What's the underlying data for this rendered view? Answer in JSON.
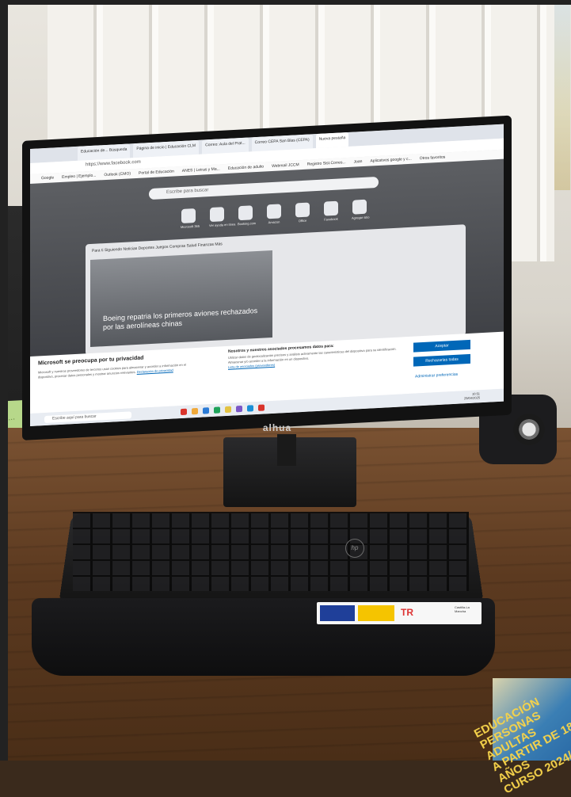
{
  "browser": {
    "tabs": [
      {
        "label": "Educación de... Búsqueda"
      },
      {
        "label": "Página de inicio | Educación CLM"
      },
      {
        "label": "Correo: Aula del Prat..."
      },
      {
        "label": "Correo CEPA San Blas (CEPA)"
      },
      {
        "label": "Nueva pestaña",
        "active": true
      }
    ],
    "url": "https://www.facebook.com",
    "bookmarks": [
      "Google",
      "Empleo | Ejemplo...",
      "Outlook (CMO)",
      "Portal de Educación",
      "ANES | Letras y Ma...",
      "Educación de adulto",
      "Webmail JCCM",
      "Registro Sist.Corres...",
      "Joan",
      "Aplicativos google y c...",
      "Otros favoritos"
    ],
    "search_placeholder": "Escribe para buscar"
  },
  "shortcuts": [
    {
      "label": "Microsoft 365"
    },
    {
      "label": "Ver ayuda en línea"
    },
    {
      "label": "Booking.com"
    },
    {
      "label": "Amazon"
    },
    {
      "label": "Office"
    },
    {
      "label": "Facebook"
    },
    {
      "label": "Agregar sitio"
    }
  ],
  "feed": {
    "nav": "Para ti   Siguiendo   Noticias   Deportes   Juegos   Compras   Salud   Finanzas   Más",
    "headline": "Boeing repatria los primeros aviones rechazados por las aerolíneas chinas"
  },
  "cookie_banner": {
    "title": "Microsoft se preocupa por tu privacidad",
    "body": "Microsoft y nuestros proveedores de terceros usan cookies para almacenar y acceder a información en el dispositivo, procesar datos personales y mostrar anuncios relevantes.",
    "policy_link": "Declaración de privacidad",
    "partners_title": "Nosotros y nuestros asociados procesamos datos para:",
    "partners_body": "Utilizar datos de geolocalización precisos y análisis activamente las características del dispositivo para su identificación. Almacenar y/o acceder a la información en un dispositivo.",
    "partners_link": "Lista de asociados (proveedores)",
    "accept_label": "Aceptar",
    "reject_label": "Rechazarlas todas",
    "preferences_label": "Administrar preferencias"
  },
  "taskbar": {
    "search_placeholder": "Escribe aquí para buscar",
    "time": "10:51",
    "date": "29/04/2025",
    "icon_colors": [
      "#d9342b",
      "#f0a93a",
      "#2b7bd6",
      "#1fa35a",
      "#e3c342",
      "#7b57c7",
      "#1b8fd6",
      "#d9342b"
    ]
  },
  "monitor_brand": "alhua",
  "sticky_note": "...",
  "keyboard_brand": "hp",
  "sticker": {
    "tr_mark": "TR",
    "region": "Castilla-La Mancha"
  },
  "poster": {
    "line1": "EDUCACIÓN",
    "line2": "PERSONAS ADULTAS",
    "line3": "A PARTIR DE 18 AÑOS",
    "line4": "CURSO 2024/"
  }
}
